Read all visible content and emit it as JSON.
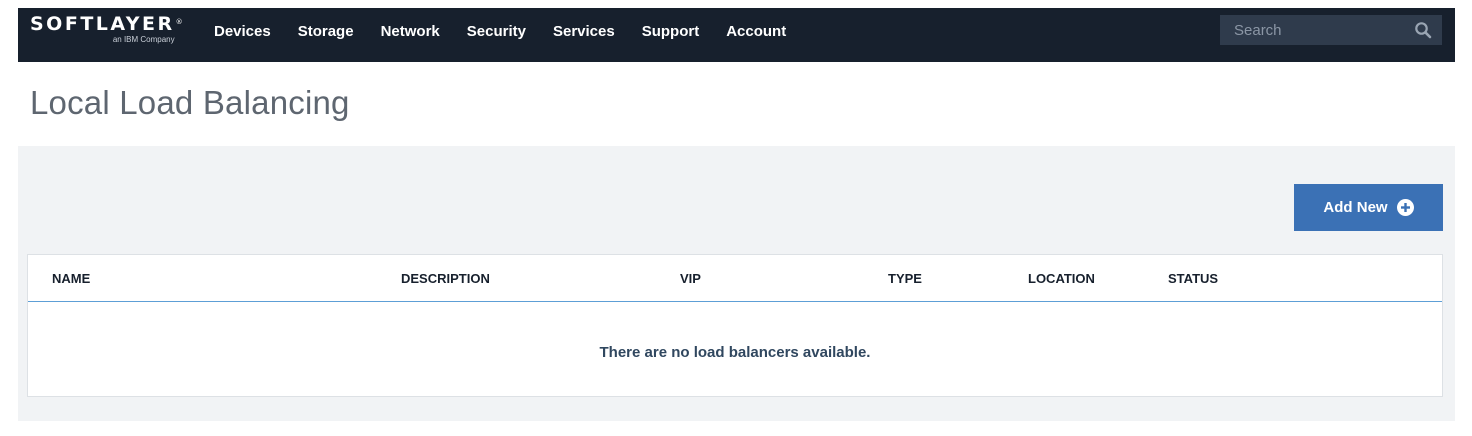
{
  "brand": {
    "name": "SOFTLAYER",
    "registered_mark": "®",
    "tagline": "an IBM Company"
  },
  "nav": {
    "items": [
      {
        "label": "Devices"
      },
      {
        "label": "Storage"
      },
      {
        "label": "Network"
      },
      {
        "label": "Security"
      },
      {
        "label": "Services"
      },
      {
        "label": "Support"
      },
      {
        "label": "Account"
      }
    ]
  },
  "search": {
    "placeholder": "Search",
    "value": "",
    "icon": "search-icon"
  },
  "page": {
    "title": "Local Load Balancing"
  },
  "toolbar": {
    "add_label": "Add New",
    "add_icon": "plus-circle-icon"
  },
  "table": {
    "columns": [
      "NAME",
      "DESCRIPTION",
      "VIP",
      "TYPE",
      "LOCATION",
      "STATUS"
    ],
    "rows": [],
    "empty_message": "There are no load balancers available."
  },
  "colors": {
    "topbar_bg": "#17202d",
    "search_bg": "#2f3b4c",
    "accent_button": "#3b71b5",
    "header_underline": "#5d9fd6",
    "panel_bg": "#f1f3f5",
    "title_text": "#5e6670"
  }
}
